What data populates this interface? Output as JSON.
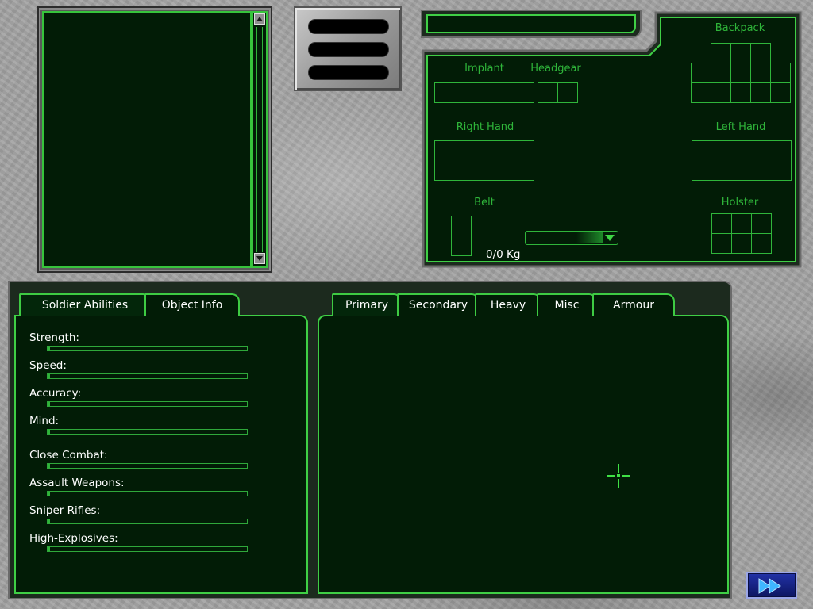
{
  "equipment": {
    "title": "",
    "slots": {
      "implant": "Implant",
      "headgear": "Headgear",
      "backpack": "Backpack",
      "right_hand": "Right Hand",
      "left_hand": "Left Hand",
      "belt": "Belt",
      "holster": "Holster"
    },
    "weight": "0/0 Kg",
    "dropdown_value": ""
  },
  "abilities_panel": {
    "tabs": [
      "Soldier Abilities",
      "Object Info"
    ],
    "stats": [
      {
        "label": "Strength:",
        "value": 0.01
      },
      {
        "label": "Speed:",
        "value": 0.01
      },
      {
        "label": "Accuracy:",
        "value": 0.01
      },
      {
        "label": "Mind:",
        "value": 0.01
      },
      {
        "label": "Close Combat:",
        "value": 0.01
      },
      {
        "label": "Assault Weapons:",
        "value": 0.01
      },
      {
        "label": "Sniper Rifles:",
        "value": 0.01
      },
      {
        "label": "High-Explosives:",
        "value": 0.01
      }
    ]
  },
  "weapons_panel": {
    "tabs": [
      "Primary",
      "Secondary",
      "Heavy",
      "Misc",
      "Armour"
    ]
  },
  "icons": {
    "next": "double-chevron-right-icon",
    "crosshair": "crosshair-icon",
    "scroll_up": "triangle-up-icon",
    "scroll_down": "triangle-down-icon",
    "dropdown": "triangle-down-icon"
  },
  "colors": {
    "accent": "#2fb53a",
    "panel": "#021c06",
    "frame": "#4fd34f"
  }
}
